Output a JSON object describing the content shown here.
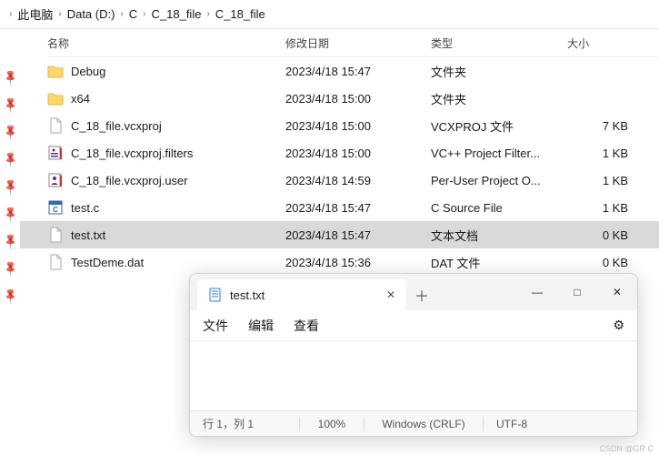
{
  "breadcrumb": {
    "root_sep": "›",
    "items": [
      "此电脑",
      "Data (D:)",
      "C",
      "C_18_file",
      "C_18_file"
    ]
  },
  "columns": {
    "name": "名称",
    "date": "修改日期",
    "type": "类型",
    "size": "大小"
  },
  "files": [
    {
      "icon": "folder",
      "name": "Debug",
      "date": "2023/4/18 15:47",
      "type": "文件夹",
      "size": "",
      "selected": false
    },
    {
      "icon": "folder",
      "name": "x64",
      "date": "2023/4/18 15:00",
      "type": "文件夹",
      "size": "",
      "selected": false
    },
    {
      "icon": "file",
      "name": "C_18_file.vcxproj",
      "date": "2023/4/18 15:00",
      "type": "VCXPROJ 文件",
      "size": "7 KB",
      "selected": false
    },
    {
      "icon": "filters",
      "name": "C_18_file.vcxproj.filters",
      "date": "2023/4/18 15:00",
      "type": "VC++ Project Filter...",
      "size": "1 KB",
      "selected": false
    },
    {
      "icon": "user",
      "name": "C_18_file.vcxproj.user",
      "date": "2023/4/18 14:59",
      "type": "Per-User Project O...",
      "size": "1 KB",
      "selected": false
    },
    {
      "icon": "csrc",
      "name": "test.c",
      "date": "2023/4/18 15:47",
      "type": "C Source File",
      "size": "1 KB",
      "selected": false
    },
    {
      "icon": "file",
      "name": "test.txt",
      "date": "2023/4/18 15:47",
      "type": "文本文档",
      "size": "0 KB",
      "selected": true
    },
    {
      "icon": "file",
      "name": "TestDeme.dat",
      "date": "2023/4/18 15:36",
      "type": "DAT 文件",
      "size": "0 KB",
      "selected": false
    }
  ],
  "notepad": {
    "tab_title": "test.txt",
    "tab_close": "✕",
    "add_tab": "＋",
    "win_min": "—",
    "win_max": "□",
    "win_close": "✕",
    "menu": {
      "file": "文件",
      "edit": "编辑",
      "view": "查看"
    },
    "settings_icon": "⚙",
    "status": {
      "cursor": "行 1，列 1",
      "zoom": "100%",
      "eol": "Windows (CRLF)",
      "enc": "UTF-8"
    }
  },
  "watermark": "CSDN @GR C"
}
